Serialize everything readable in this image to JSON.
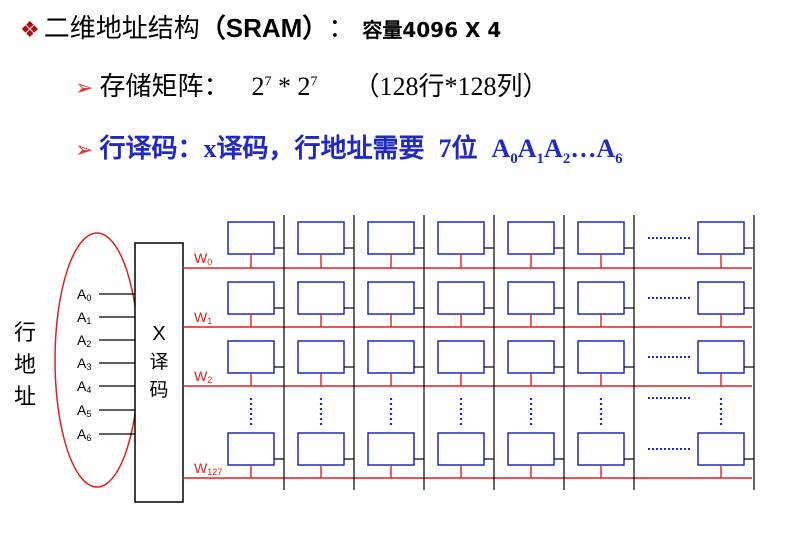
{
  "title": {
    "bullet": "❖",
    "main_cn": "二维地址结构",
    "main_en": "（SRAM）",
    "colon": "：",
    "capacity": "容量4096 X 4"
  },
  "line2": {
    "arrow": "➢",
    "label": "存储矩阵：",
    "expr_base1": "2",
    "expr_exp1": "7",
    "expr_op": " * ",
    "expr_base2": "2",
    "expr_exp2": "7",
    "paren": "（128行*128列）"
  },
  "line3": {
    "arrow": "➢",
    "label": "行译码：",
    "x_part": "x译码，行地址需要",
    "count": "7位",
    "addr_sequence": [
      {
        "letter": "A",
        "index": "0"
      },
      {
        "letter": "A",
        "index": "1"
      },
      {
        "letter": "A",
        "index": "2"
      },
      {
        "letter": "…",
        "index": ""
      },
      {
        "letter": "A",
        "index": "6"
      }
    ]
  },
  "diagram": {
    "side_label": [
      "行",
      "地",
      "址"
    ],
    "address_inputs": [
      {
        "letter": "A",
        "index": "0"
      },
      {
        "letter": "A",
        "index": "1"
      },
      {
        "letter": "A",
        "index": "2"
      },
      {
        "letter": "A",
        "index": "3"
      },
      {
        "letter": "A",
        "index": "4"
      },
      {
        "letter": "A",
        "index": "5"
      },
      {
        "letter": "A",
        "index": "6"
      }
    ],
    "decoder_label": [
      "X",
      "译",
      "码"
    ],
    "word_lines": [
      {
        "letter": "W",
        "index": "0"
      },
      {
        "letter": "W",
        "index": "1"
      },
      {
        "letter": "W",
        "index": "2"
      },
      {
        "letter": "W",
        "index": "127"
      }
    ],
    "colors": {
      "cell_border": "#1f28c8",
      "word_line": "#e02020",
      "ellipse": "#e02020",
      "dots": "#1f28c8",
      "black": "#000000"
    }
  }
}
